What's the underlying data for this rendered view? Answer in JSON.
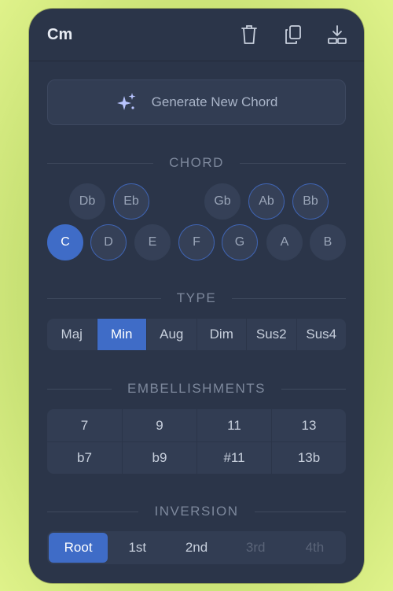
{
  "header": {
    "title": "Cm",
    "icons": [
      "trash-icon",
      "copy-icon",
      "download-icon"
    ]
  },
  "generate": {
    "label": "Generate New Chord",
    "icon": "sparkle-icon"
  },
  "sections": {
    "chord": "CHORD",
    "type": "TYPE",
    "embellishments": "EMBELLISHMENTS",
    "inversion": "INVERSION"
  },
  "chord": {
    "accidentals": [
      "Db",
      "Eb",
      "Gb",
      "Ab",
      "Bb"
    ],
    "naturals": [
      "C",
      "D",
      "E",
      "F",
      "G",
      "A",
      "B"
    ],
    "selected": "C",
    "highlighted": [
      "Eb",
      "Ab",
      "Bb",
      "D",
      "F",
      "G"
    ]
  },
  "type": {
    "options": [
      "Maj",
      "Min",
      "Aug",
      "Dim",
      "Sus2",
      "Sus4"
    ],
    "selected": "Min"
  },
  "embellishments": {
    "row1": [
      "7",
      "9",
      "11",
      "13"
    ],
    "row2": [
      "b7",
      "b9",
      "#11",
      "13b"
    ]
  },
  "inversion": {
    "options": [
      "Root",
      "1st",
      "2nd",
      "3rd",
      "4th"
    ],
    "selected": "Root",
    "disabled": [
      "3rd",
      "4th"
    ]
  },
  "colors": {
    "accent": "#3f6cc7",
    "panel": "#2b3549",
    "ring": "#3f63b0"
  }
}
